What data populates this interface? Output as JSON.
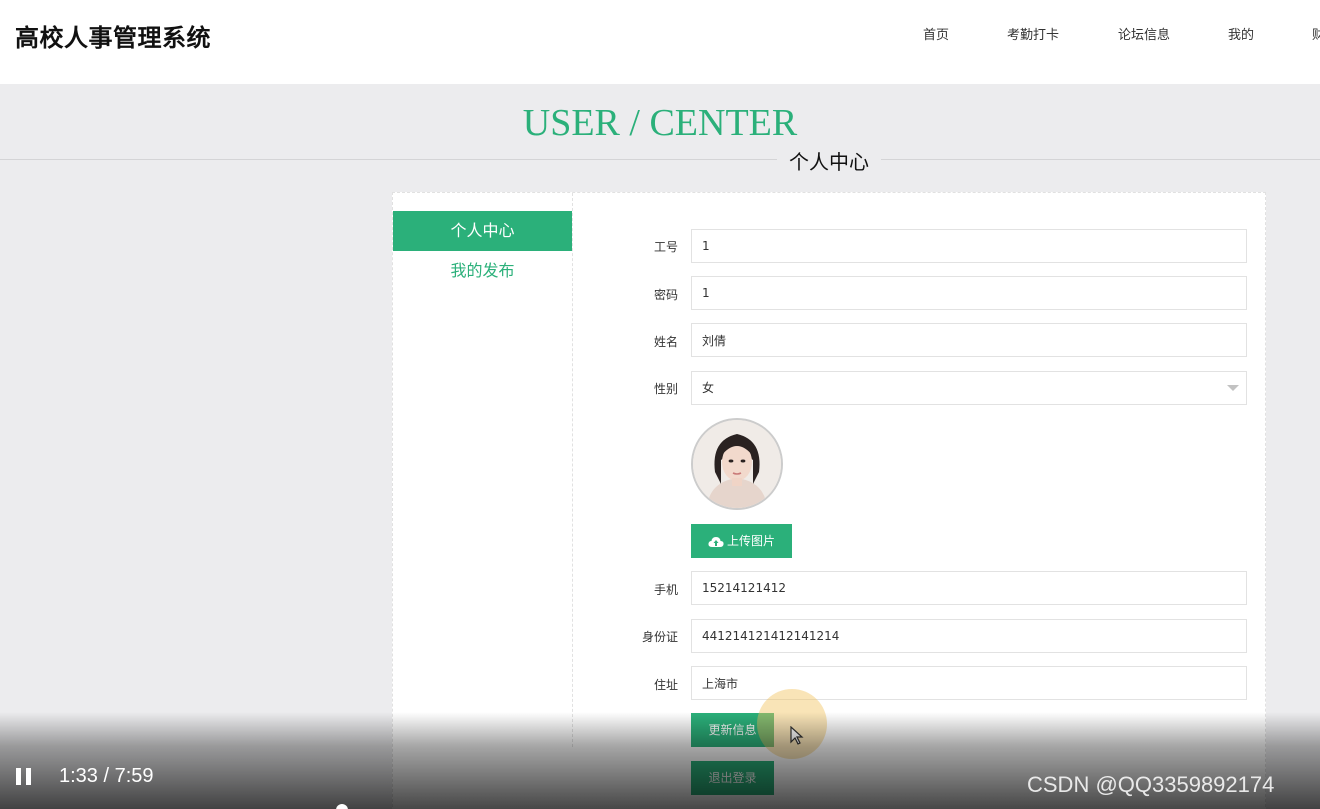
{
  "header": {
    "site_title": "高校人事管理系统",
    "nav": [
      "首页",
      "考勤打卡",
      "论坛信息",
      "我的",
      "财"
    ]
  },
  "hero": {
    "title": "USER / CENTER",
    "subtitle": "个人中心"
  },
  "sidebar": {
    "items": [
      {
        "label": "个人中心",
        "active": true
      },
      {
        "label": "我的发布",
        "active": false
      }
    ]
  },
  "form": {
    "fields": [
      {
        "label": "工号",
        "value": "1"
      },
      {
        "label": "密码",
        "value": "1"
      },
      {
        "label": "姓名",
        "value": "刘倩"
      },
      {
        "label": "性别",
        "value": "女"
      },
      {
        "label": "手机",
        "value": "15214121412"
      },
      {
        "label": "身份证",
        "value": "441214121412141214"
      },
      {
        "label": "住址",
        "value": "上海市"
      }
    ],
    "upload_label": "上传图片",
    "update_label": "更新信息",
    "logout_label": "退出登录"
  },
  "video": {
    "time": "1:33 / 7:59",
    "watermark": "CSDN @QQ3359892174"
  },
  "colors": {
    "accent": "#2bb07a",
    "background": "#ececee"
  }
}
